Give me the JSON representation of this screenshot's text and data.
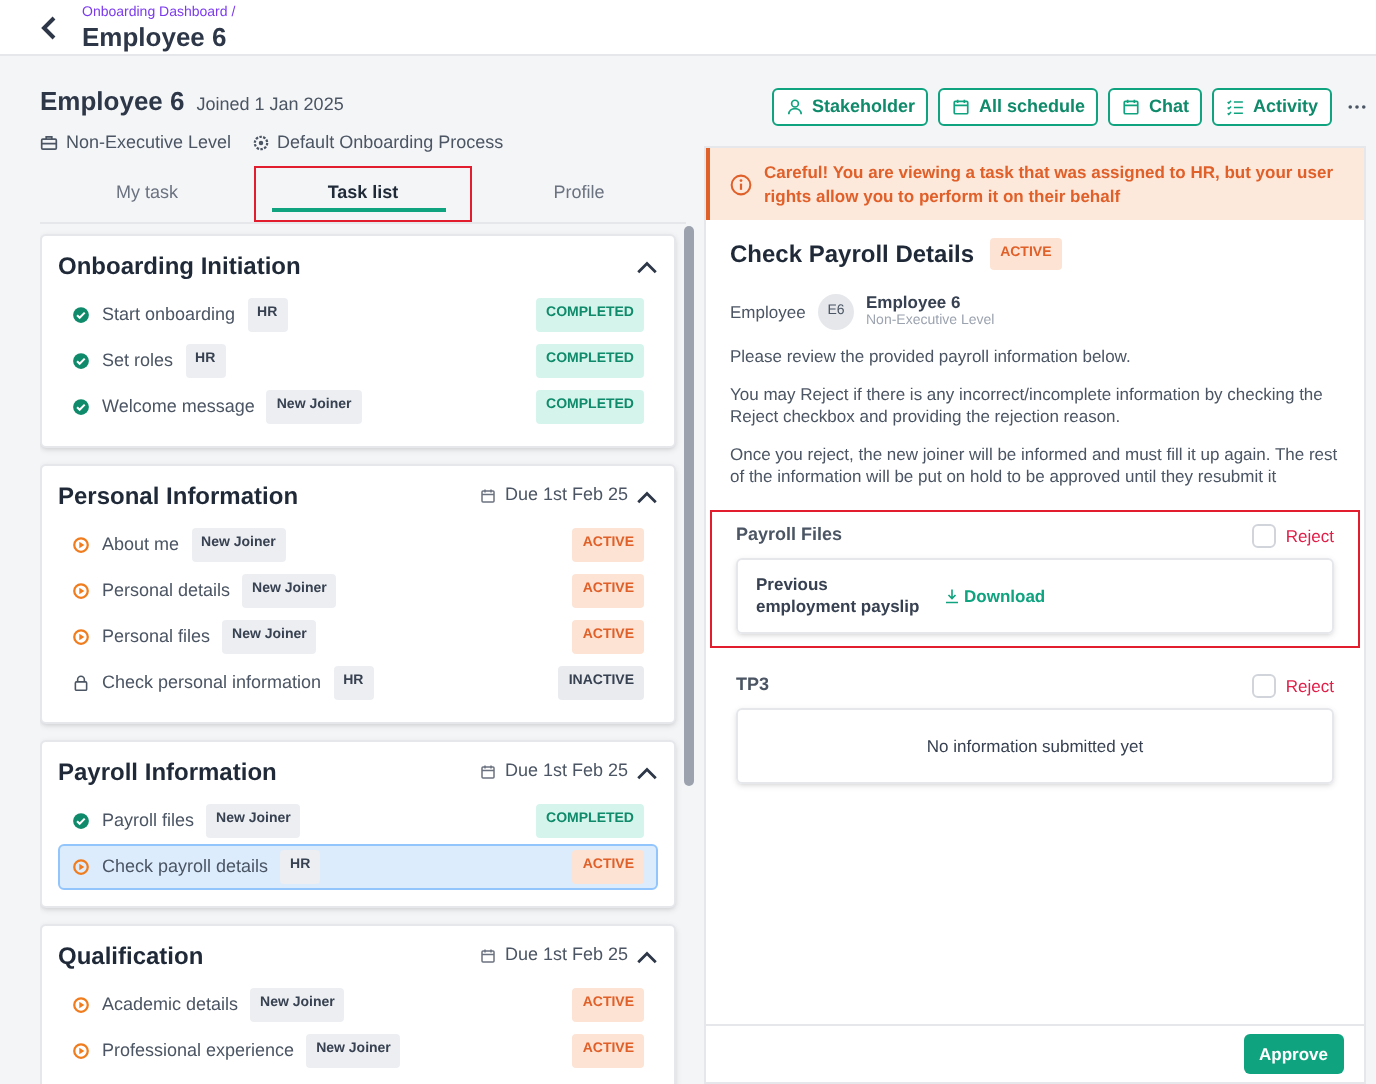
{
  "header": {
    "breadcrumb": "Onboarding Dashboard /",
    "title": "Employee 6"
  },
  "employee": {
    "name": "Employee 6",
    "joined": "Joined 1 Jan 2025",
    "level": "Non-Executive Level",
    "process": "Default Onboarding Process"
  },
  "actions": [
    {
      "label": "Stakeholder",
      "kind": "person"
    },
    {
      "label": "All schedule",
      "kind": "calendar"
    },
    {
      "label": "Chat",
      "kind": "calendar"
    },
    {
      "label": "Activity",
      "kind": "list"
    }
  ],
  "tabs": [
    {
      "label": "My task",
      "selected": false,
      "highlighted": false
    },
    {
      "label": "Task list",
      "selected": true,
      "highlighted": true
    },
    {
      "label": "Profile",
      "selected": false,
      "highlighted": false
    }
  ],
  "sections": [
    {
      "title": "Onboarding Initiation",
      "expanded": true,
      "tasks": [
        {
          "name": "Start onboarding",
          "assignee": "HR",
          "status": "COMPLETED",
          "kind": "completed",
          "selected": false
        },
        {
          "name": "Set roles",
          "assignee": "HR",
          "status": "COMPLETED",
          "kind": "completed",
          "selected": false
        },
        {
          "name": "Welcome message",
          "assignee": "New Joiner",
          "status": "COMPLETED",
          "kind": "completed",
          "selected": false
        }
      ]
    },
    {
      "title": "Personal Information",
      "due": "Due 1st Feb 25",
      "expanded": true,
      "tasks": [
        {
          "name": "About me",
          "assignee": "New Joiner",
          "status": "ACTIVE",
          "kind": "active",
          "selected": false
        },
        {
          "name": "Personal details",
          "assignee": "New Joiner",
          "status": "ACTIVE",
          "kind": "active",
          "selected": false
        },
        {
          "name": "Personal files",
          "assignee": "New Joiner",
          "status": "ACTIVE",
          "kind": "active",
          "selected": false
        },
        {
          "name": "Check personal information",
          "assignee": "HR",
          "status": "INACTIVE",
          "kind": "inactive",
          "selected": false
        }
      ]
    },
    {
      "title": "Payroll Information",
      "due": "Due 1st Feb 25",
      "expanded": true,
      "tasks": [
        {
          "name": "Payroll files",
          "assignee": "New Joiner",
          "status": "COMPLETED",
          "kind": "completed",
          "selected": false
        },
        {
          "name": "Check payroll details",
          "assignee": "HR",
          "status": "ACTIVE",
          "kind": "active",
          "selected": true
        }
      ]
    },
    {
      "title": "Qualification",
      "due": "Due 1st Feb 25",
      "expanded": true,
      "tasks": [
        {
          "name": "Academic details",
          "assignee": "New Joiner",
          "status": "ACTIVE",
          "kind": "active",
          "selected": false
        },
        {
          "name": "Professional experience",
          "assignee": "New Joiner",
          "status": "ACTIVE",
          "kind": "active",
          "selected": false
        }
      ]
    }
  ],
  "task_panel": {
    "alert": "Careful! You are viewing a task that was assigned to HR, but your user rights allow you to perform it on their behalf",
    "title": "Check Payroll Details",
    "status": "ACTIVE",
    "employee_label": "Employee",
    "employee_initials": "E6",
    "employee_name": "Employee 6",
    "employee_level": "Non-Executive Level",
    "paragraphs": [
      "Please review the provided payroll information below.",
      "You may Reject if there is any incorrect/incomplete information by checking the Reject checkbox and providing the rejection reason.",
      "Once you reject, the new joiner will be informed and must fill it up again. The rest of the information will be put on hold to be approved until they resubmit it"
    ],
    "file_sections": [
      {
        "title": "Payroll Files",
        "reject_label": "Reject",
        "reject_checked": false,
        "highlighted": true,
        "files": [
          {
            "name": "Previous employment payslip",
            "action": "Download"
          }
        ]
      },
      {
        "title": "TP3",
        "reject_label": "Reject",
        "reject_checked": false,
        "highlighted": false,
        "empty_text": "No information submitted yet"
      }
    ],
    "approve": "Approve"
  }
}
